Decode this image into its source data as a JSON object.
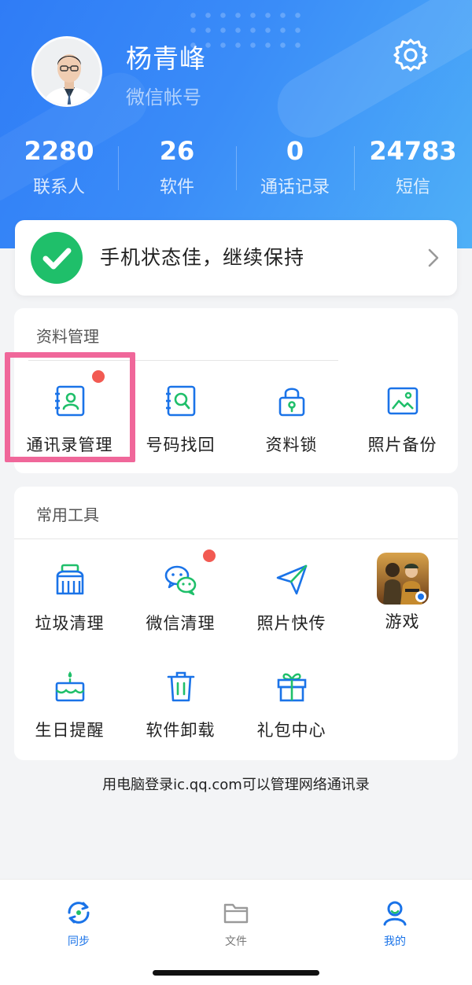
{
  "profile": {
    "name": "杨青峰",
    "subtitle": "微信帐号"
  },
  "stats": [
    {
      "value": "2280",
      "label": "联系人"
    },
    {
      "value": "26",
      "label": "软件"
    },
    {
      "value": "0",
      "label": "通话记录"
    },
    {
      "value": "24783",
      "label": "短信"
    }
  ],
  "status": {
    "text": "手机状态佳，继续保持"
  },
  "data_management": {
    "title": "资料管理",
    "items": [
      {
        "label": "通讯录管理",
        "icon": "contacts-book-icon"
      },
      {
        "label": "号码找回",
        "icon": "number-search-icon"
      },
      {
        "label": "资料锁",
        "icon": "lock-icon"
      },
      {
        "label": "照片备份",
        "icon": "photo-icon"
      }
    ]
  },
  "tools": {
    "title": "常用工具",
    "items": [
      {
        "label": "垃圾清理",
        "icon": "broom-icon"
      },
      {
        "label": "微信清理",
        "icon": "wechat-icon"
      },
      {
        "label": "照片快传",
        "icon": "paper-plane-icon"
      },
      {
        "label": "游戏",
        "icon": "game-thumbnail"
      },
      {
        "label": "生日提醒",
        "icon": "birthday-cake-icon"
      },
      {
        "label": "软件卸载",
        "icon": "trash-icon"
      },
      {
        "label": "礼包中心",
        "icon": "gift-icon"
      }
    ]
  },
  "footnote": "用电脑登录ic.qq.com可以管理网络通讯录",
  "bottom_nav": [
    {
      "label": "同步",
      "icon": "sync-icon",
      "active": true
    },
    {
      "label": "文件",
      "icon": "folder-icon",
      "active": false
    },
    {
      "label": "我的",
      "icon": "profile-icon",
      "active": true
    }
  ],
  "colors": {
    "header_blue": "#2f7cf6",
    "icon_blue": "#1a73e8",
    "icon_green": "#1fbf6a",
    "badge_red": "#f25a52",
    "highlight_pink": "#f0679a"
  }
}
